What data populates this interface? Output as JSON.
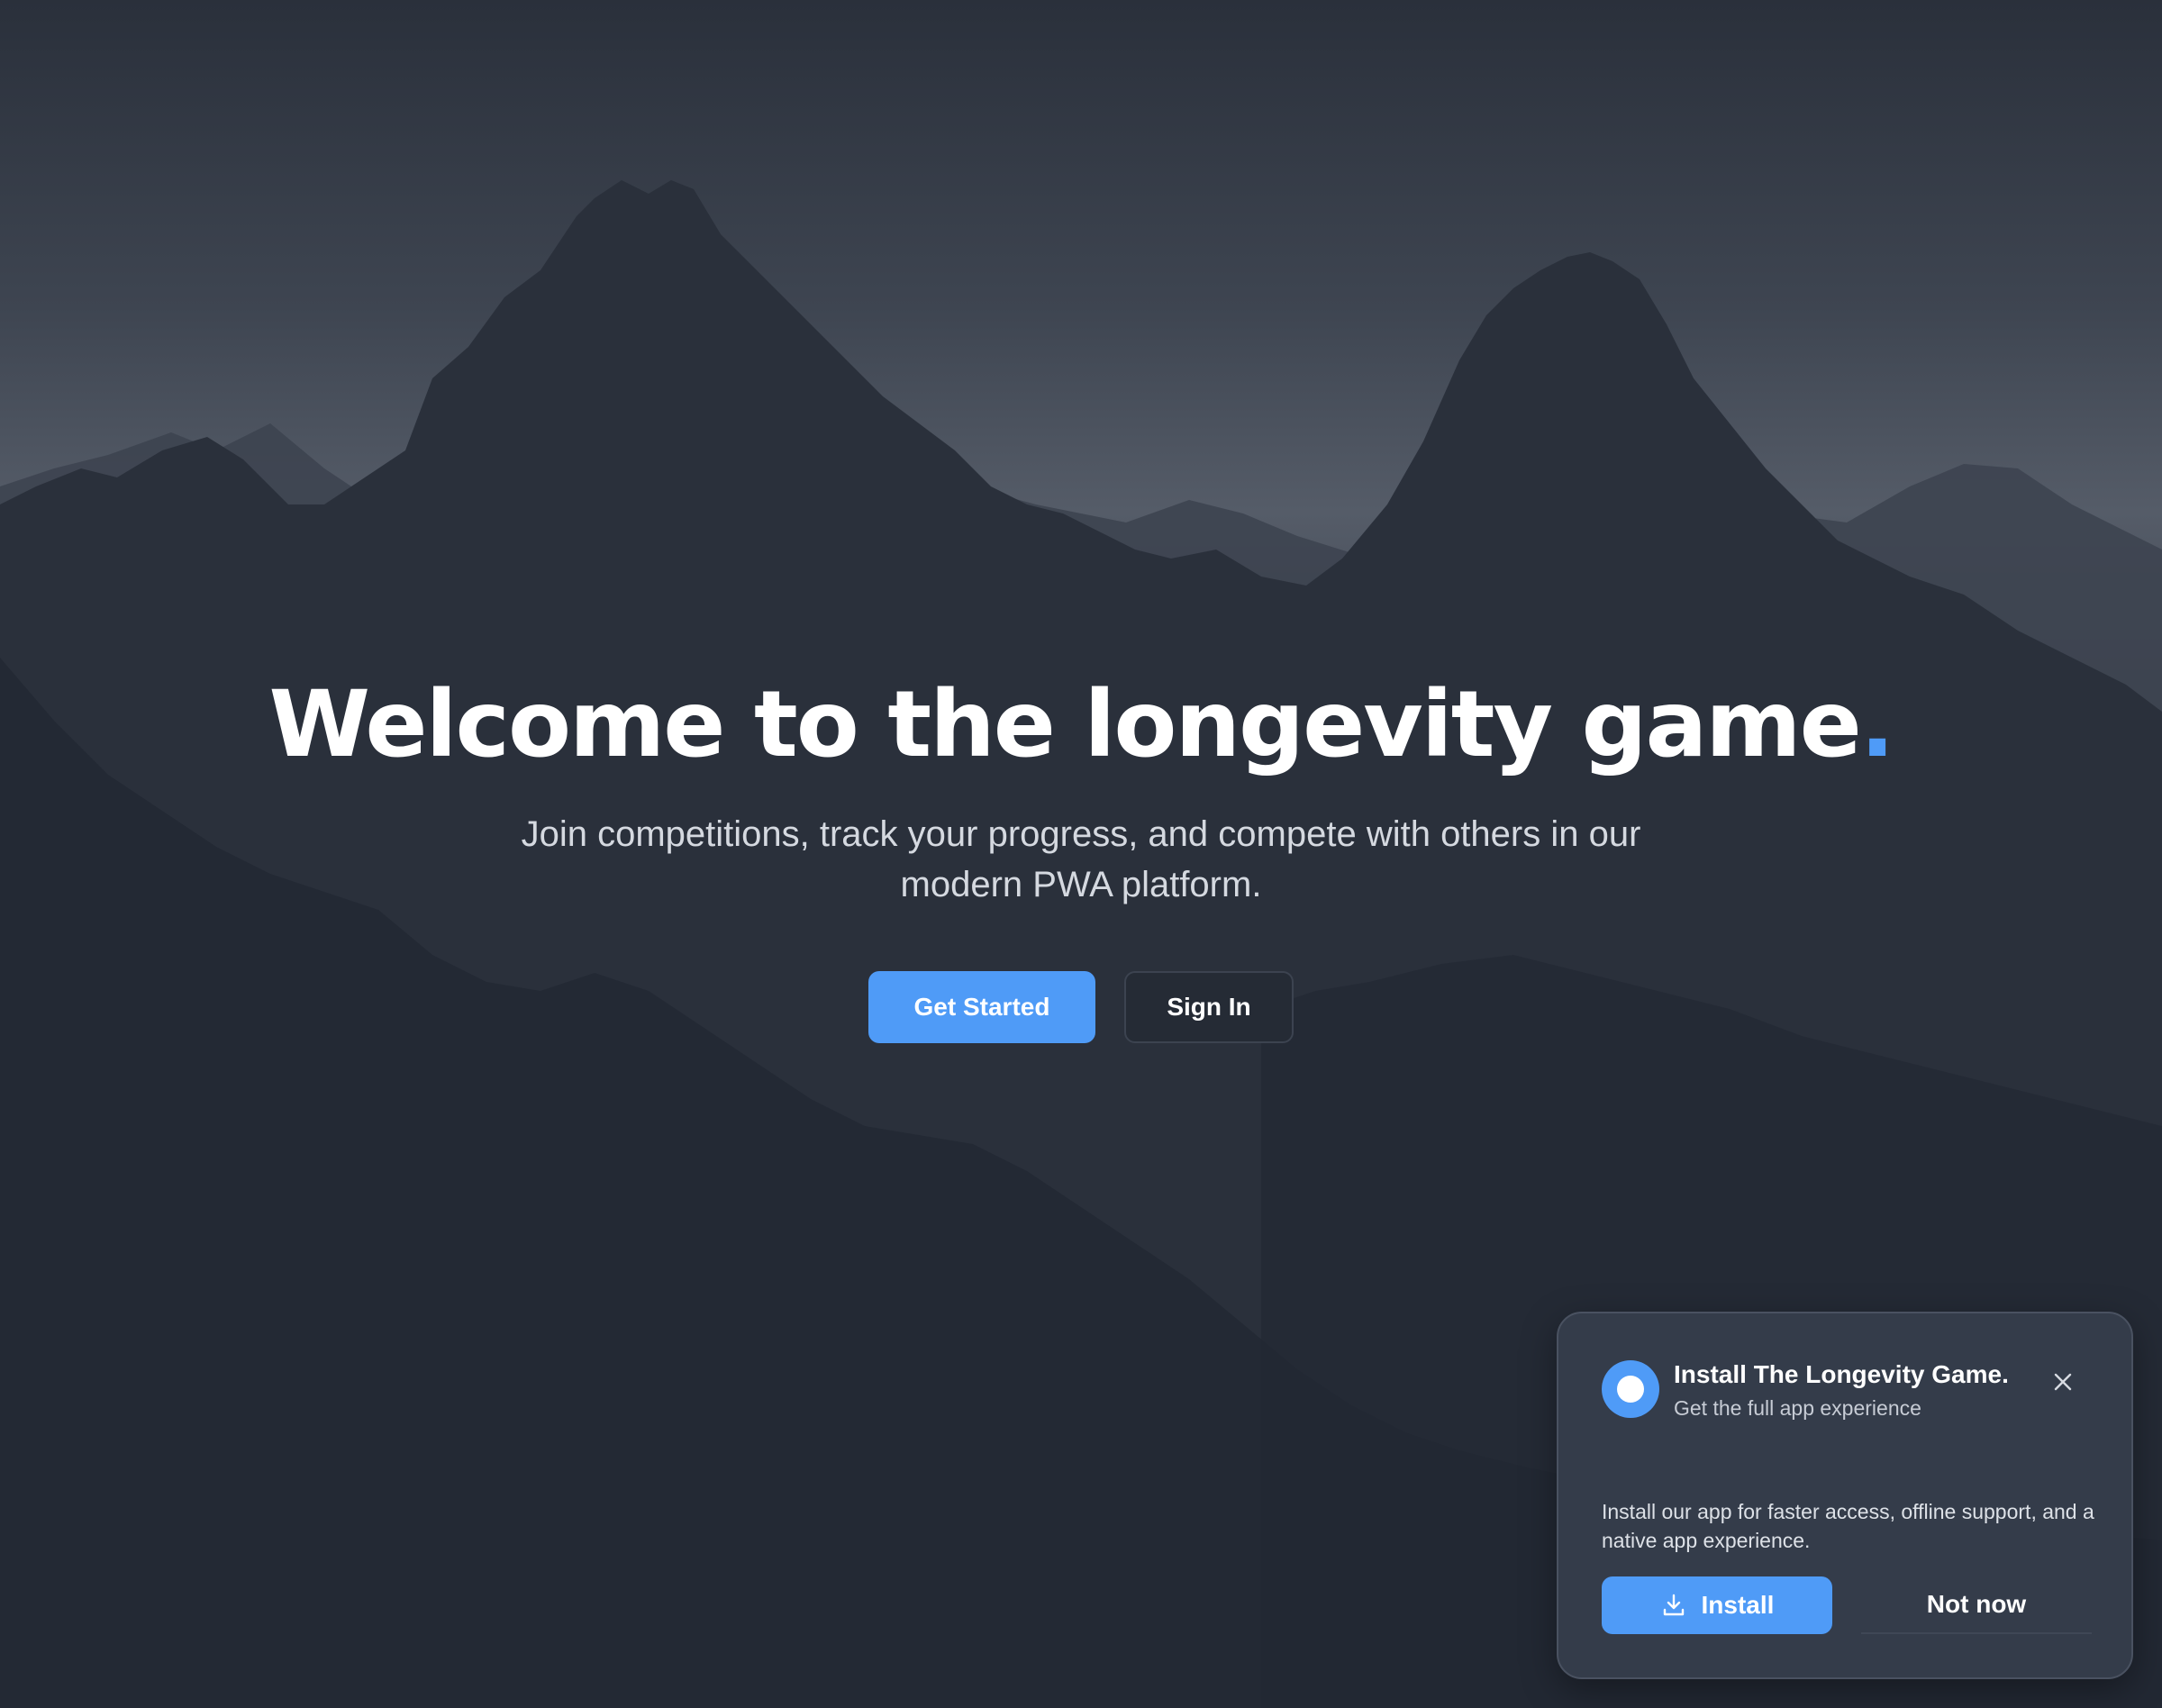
{
  "hero": {
    "title": "Welcome to the longevity game",
    "title_dot": ".",
    "subtitle": "Join competitions, track your progress, and compete with others in our modern PWA platform.",
    "primary_button": "Get Started",
    "secondary_button": "Sign In"
  },
  "install_prompt": {
    "title": "Install The Longevity Game.",
    "subtitle": "Get the full app experience",
    "body": "Install our app for faster access, offline support, and a native app experience.",
    "install_button": "Install",
    "dismiss_button": "Not now",
    "install_icon": "download-icon",
    "close_icon": "close-icon"
  },
  "colors": {
    "accent": "#4f9bf7",
    "card_background": "#343c4a",
    "page_background": "#1f2530"
  }
}
